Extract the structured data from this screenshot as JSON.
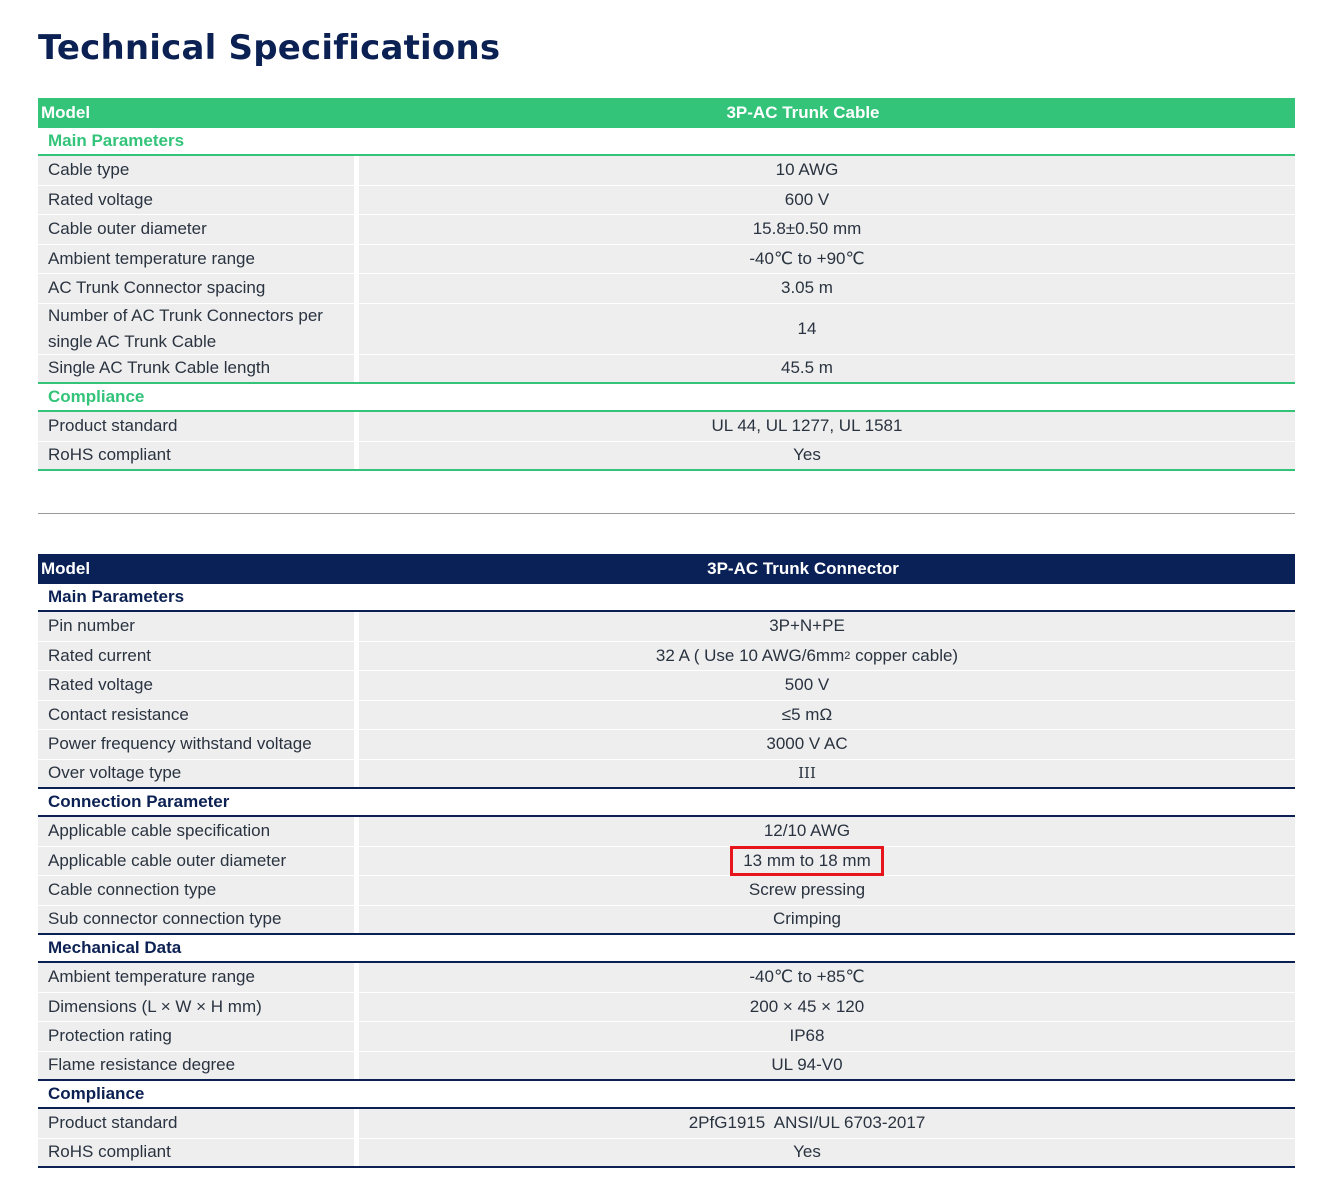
{
  "title": "Technical Specifications",
  "cable_table": {
    "header_label": "Model",
    "header_value": "3P-AC Trunk Cable",
    "sections": [
      {
        "name": "Main Parameters",
        "rows": [
          {
            "label": "Cable type",
            "value": "10 AWG"
          },
          {
            "label": "Rated voltage",
            "value": "600 V"
          },
          {
            "label": "Cable outer diameter",
            "value": "15.8±0.50 mm"
          },
          {
            "label": "Ambient temperature range",
            "value": "-40℃ to +90℃"
          },
          {
            "label": "AC Trunk Connector spacing",
            "value": "3.05 m"
          },
          {
            "label": "Number of AC Trunk Connectors per single AC Trunk Cable",
            "value": "14"
          },
          {
            "label": "Single AC Trunk Cable length",
            "value": "45.5 m"
          }
        ]
      },
      {
        "name": "Compliance",
        "rows": [
          {
            "label": "Product standard",
            "value": "UL 44, UL 1277, UL 1581"
          },
          {
            "label": "RoHS compliant",
            "value": "Yes"
          }
        ]
      }
    ]
  },
  "connector_table": {
    "header_label": "Model",
    "header_value": "3P-AC Trunk Connector",
    "sections": [
      {
        "name": "Main Parameters",
        "rows": [
          {
            "label": "Pin number",
            "value": "3P+N+PE"
          },
          {
            "label": "Rated current",
            "value_pre": "32 A ( Use 10 AWG/6mm",
            "value_sup": "2",
            "value_post": " copper cable)"
          },
          {
            "label": "Rated voltage",
            "value": "500 V"
          },
          {
            "label": "Contact resistance",
            "value": "≤5 mΩ"
          },
          {
            "label": "Power frequency withstand voltage",
            "value": "3000 V AC"
          },
          {
            "label": "Over voltage type",
            "value": "III"
          }
        ]
      },
      {
        "name": "Connection Parameter",
        "rows": [
          {
            "label": "Applicable cable specification",
            "value": "12/10 AWG"
          },
          {
            "label": "Applicable cable outer diameter",
            "value": "13 mm to 18 mm"
          },
          {
            "label": "Cable connection type",
            "value": "Screw pressing"
          },
          {
            "label": "Sub connector connection type",
            "value": "Crimping"
          }
        ]
      },
      {
        "name": "Mechanical Data",
        "rows": [
          {
            "label": "Ambient temperature range",
            "value": "-40℃ to +85℃"
          },
          {
            "label": "Dimensions (L × W × H mm)",
            "value": "200 × 45 × 120"
          },
          {
            "label": "Protection rating",
            "value": "IP68"
          },
          {
            "label": "Flame resistance degree",
            "value": "UL 94-V0"
          }
        ]
      },
      {
        "name": "Compliance",
        "rows": [
          {
            "label": "Product standard",
            "value": "2PfG1915  ANSI/UL 6703-2017"
          },
          {
            "label": "RoHS compliant",
            "value": "Yes"
          }
        ]
      }
    ]
  },
  "colors": {
    "green": "#33c47a",
    "navy": "#0a2158",
    "highlight": "#e8141b"
  }
}
